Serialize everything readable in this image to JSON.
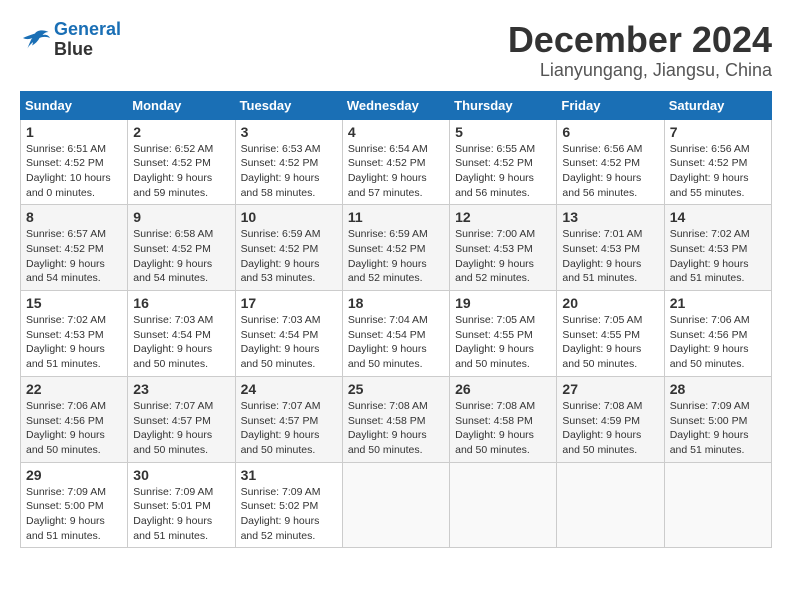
{
  "header": {
    "logo_line1": "General",
    "logo_line2": "Blue",
    "month": "December 2024",
    "location": "Lianyungang, Jiangsu, China"
  },
  "weekdays": [
    "Sunday",
    "Monday",
    "Tuesday",
    "Wednesday",
    "Thursday",
    "Friday",
    "Saturday"
  ],
  "weeks": [
    [
      {
        "day": "1",
        "info": "Sunrise: 6:51 AM\nSunset: 4:52 PM\nDaylight: 10 hours\nand 0 minutes."
      },
      {
        "day": "2",
        "info": "Sunrise: 6:52 AM\nSunset: 4:52 PM\nDaylight: 9 hours\nand 59 minutes."
      },
      {
        "day": "3",
        "info": "Sunrise: 6:53 AM\nSunset: 4:52 PM\nDaylight: 9 hours\nand 58 minutes."
      },
      {
        "day": "4",
        "info": "Sunrise: 6:54 AM\nSunset: 4:52 PM\nDaylight: 9 hours\nand 57 minutes."
      },
      {
        "day": "5",
        "info": "Sunrise: 6:55 AM\nSunset: 4:52 PM\nDaylight: 9 hours\nand 56 minutes."
      },
      {
        "day": "6",
        "info": "Sunrise: 6:56 AM\nSunset: 4:52 PM\nDaylight: 9 hours\nand 56 minutes."
      },
      {
        "day": "7",
        "info": "Sunrise: 6:56 AM\nSunset: 4:52 PM\nDaylight: 9 hours\nand 55 minutes."
      }
    ],
    [
      {
        "day": "8",
        "info": "Sunrise: 6:57 AM\nSunset: 4:52 PM\nDaylight: 9 hours\nand 54 minutes."
      },
      {
        "day": "9",
        "info": "Sunrise: 6:58 AM\nSunset: 4:52 PM\nDaylight: 9 hours\nand 54 minutes."
      },
      {
        "day": "10",
        "info": "Sunrise: 6:59 AM\nSunset: 4:52 PM\nDaylight: 9 hours\nand 53 minutes."
      },
      {
        "day": "11",
        "info": "Sunrise: 6:59 AM\nSunset: 4:52 PM\nDaylight: 9 hours\nand 52 minutes."
      },
      {
        "day": "12",
        "info": "Sunrise: 7:00 AM\nSunset: 4:53 PM\nDaylight: 9 hours\nand 52 minutes."
      },
      {
        "day": "13",
        "info": "Sunrise: 7:01 AM\nSunset: 4:53 PM\nDaylight: 9 hours\nand 51 minutes."
      },
      {
        "day": "14",
        "info": "Sunrise: 7:02 AM\nSunset: 4:53 PM\nDaylight: 9 hours\nand 51 minutes."
      }
    ],
    [
      {
        "day": "15",
        "info": "Sunrise: 7:02 AM\nSunset: 4:53 PM\nDaylight: 9 hours\nand 51 minutes."
      },
      {
        "day": "16",
        "info": "Sunrise: 7:03 AM\nSunset: 4:54 PM\nDaylight: 9 hours\nand 50 minutes."
      },
      {
        "day": "17",
        "info": "Sunrise: 7:03 AM\nSunset: 4:54 PM\nDaylight: 9 hours\nand 50 minutes."
      },
      {
        "day": "18",
        "info": "Sunrise: 7:04 AM\nSunset: 4:54 PM\nDaylight: 9 hours\nand 50 minutes."
      },
      {
        "day": "19",
        "info": "Sunrise: 7:05 AM\nSunset: 4:55 PM\nDaylight: 9 hours\nand 50 minutes."
      },
      {
        "day": "20",
        "info": "Sunrise: 7:05 AM\nSunset: 4:55 PM\nDaylight: 9 hours\nand 50 minutes."
      },
      {
        "day": "21",
        "info": "Sunrise: 7:06 AM\nSunset: 4:56 PM\nDaylight: 9 hours\nand 50 minutes."
      }
    ],
    [
      {
        "day": "22",
        "info": "Sunrise: 7:06 AM\nSunset: 4:56 PM\nDaylight: 9 hours\nand 50 minutes."
      },
      {
        "day": "23",
        "info": "Sunrise: 7:07 AM\nSunset: 4:57 PM\nDaylight: 9 hours\nand 50 minutes."
      },
      {
        "day": "24",
        "info": "Sunrise: 7:07 AM\nSunset: 4:57 PM\nDaylight: 9 hours\nand 50 minutes."
      },
      {
        "day": "25",
        "info": "Sunrise: 7:08 AM\nSunset: 4:58 PM\nDaylight: 9 hours\nand 50 minutes."
      },
      {
        "day": "26",
        "info": "Sunrise: 7:08 AM\nSunset: 4:58 PM\nDaylight: 9 hours\nand 50 minutes."
      },
      {
        "day": "27",
        "info": "Sunrise: 7:08 AM\nSunset: 4:59 PM\nDaylight: 9 hours\nand 50 minutes."
      },
      {
        "day": "28",
        "info": "Sunrise: 7:09 AM\nSunset: 5:00 PM\nDaylight: 9 hours\nand 51 minutes."
      }
    ],
    [
      {
        "day": "29",
        "info": "Sunrise: 7:09 AM\nSunset: 5:00 PM\nDaylight: 9 hours\nand 51 minutes."
      },
      {
        "day": "30",
        "info": "Sunrise: 7:09 AM\nSunset: 5:01 PM\nDaylight: 9 hours\nand 51 minutes."
      },
      {
        "day": "31",
        "info": "Sunrise: 7:09 AM\nSunset: 5:02 PM\nDaylight: 9 hours\nand 52 minutes."
      },
      {
        "day": "",
        "info": ""
      },
      {
        "day": "",
        "info": ""
      },
      {
        "day": "",
        "info": ""
      },
      {
        "day": "",
        "info": ""
      }
    ]
  ]
}
